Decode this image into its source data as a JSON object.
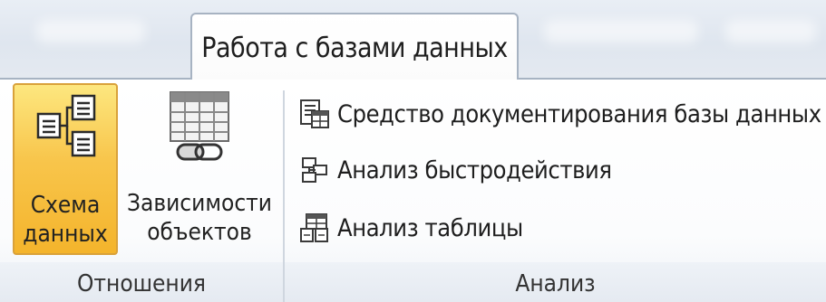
{
  "ribbon": {
    "tab_label": "Работа с базами данных",
    "groups": {
      "relations": {
        "label": "Отношения",
        "buttons": {
          "schema": {
            "line1": "Схема",
            "line2": "данных",
            "icon": "relationships-icon",
            "active": true
          },
          "dependencies": {
            "line1": "Зависимости",
            "line2": "объектов",
            "icon": "object-dependencies-icon"
          }
        }
      },
      "analysis": {
        "label": "Анализ",
        "buttons": {
          "documenter": {
            "label": "Средство документирования базы данных",
            "icon": "database-documenter-icon"
          },
          "performance": {
            "label": "Анализ быстродействия",
            "icon": "analyze-performance-icon"
          },
          "table": {
            "label": "Анализ таблицы",
            "icon": "analyze-table-icon"
          }
        }
      }
    }
  },
  "colors": {
    "active_button": "#f8c54b",
    "tab_border": "#a7b3c2",
    "ribbon_bg": "#ffffff"
  }
}
